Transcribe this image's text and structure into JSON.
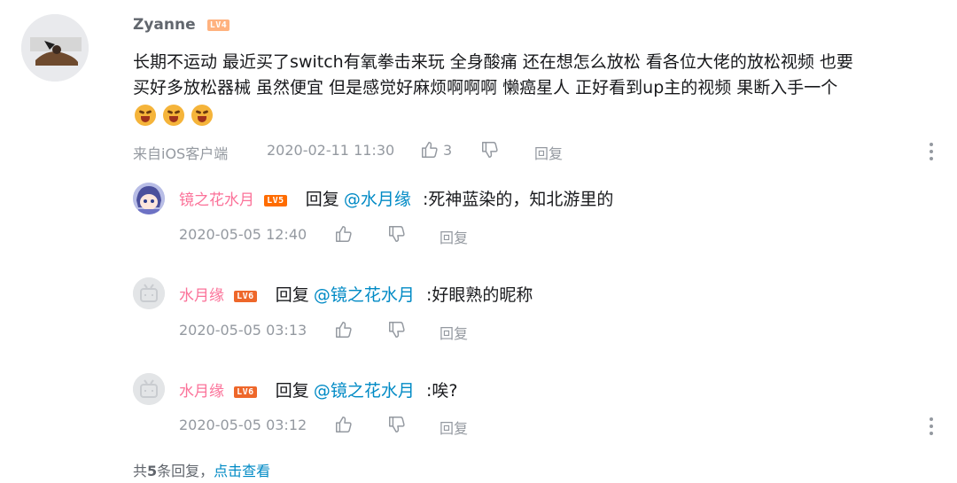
{
  "comment": {
    "username": "Zyanne",
    "level": "LV4",
    "text_line1": "长期不运动 最近买了switch有氧拳击来玩 全身酸痛 还在想怎么放松 看各位大佬的放松视频 也要",
    "text_line2": "买好多放松器械 虽然便宜 但是感觉好麻烦啊啊啊 懒癌星人 正好看到up主的视频 果断入手一个",
    "emoji_count": 3,
    "source": "来自iOS客户端",
    "time": "2020-02-11 11:30",
    "likes": "3",
    "reply_label": "回复"
  },
  "replies": [
    {
      "username": "镜之花水月",
      "level": "LV5",
      "reply_prefix": "回复",
      "mention": "@水月缘",
      "text": ":死神蓝染的，知北游里的",
      "time": "2020-05-05 12:40",
      "reply_label": "回复"
    },
    {
      "username": "水月缘",
      "level": "LV6",
      "reply_prefix": "回复",
      "mention": "@镜之花水月",
      "text": ":好眼熟的昵称",
      "time": "2020-05-05 03:13",
      "reply_label": "回复"
    },
    {
      "username": "水月缘",
      "level": "LV6",
      "reply_prefix": "回复",
      "mention": "@镜之花水月",
      "text": ":唉?",
      "time": "2020-05-05 03:12",
      "reply_label": "回复"
    }
  ],
  "footer": {
    "total_prefix": "共",
    "total_count": "5",
    "total_suffix": "条回复，",
    "view_link": "点击查看"
  },
  "colors": {
    "username_pink": "#fb7299",
    "mention_blue": "#008ac5",
    "meta_gray": "#9499a0"
  }
}
